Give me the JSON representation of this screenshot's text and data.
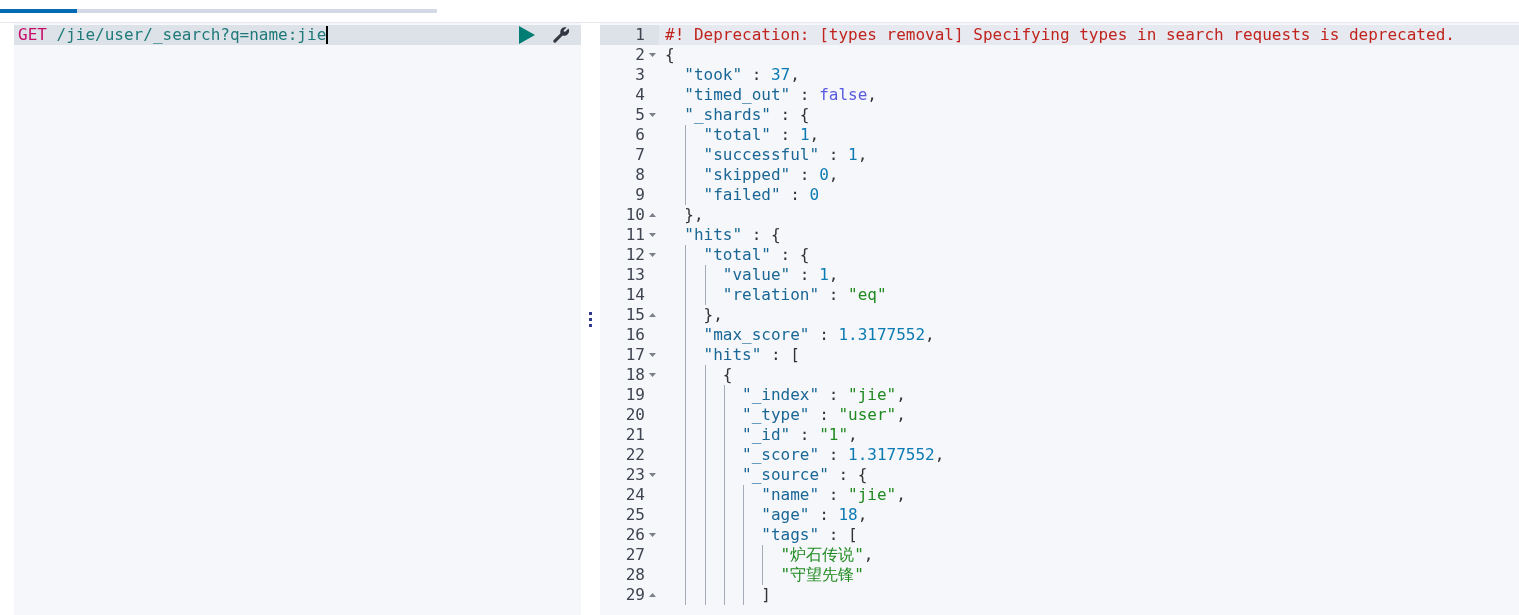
{
  "tabs": [
    {
      "selected": true
    },
    {
      "selected": false
    }
  ],
  "request": {
    "method": "GET",
    "path": "/jie/user/_search?q=name:jie"
  },
  "response": {
    "lines": [
      {
        "number": "1",
        "fold_start": false,
        "fold_end": false,
        "active": true,
        "tokens": [
          {
            "kind": "comment",
            "text": "#! Deprecation: [types removal] Specifying types in search requests is deprecated."
          }
        ]
      },
      {
        "number": "2",
        "fold_start": true,
        "fold_end": false,
        "active": false,
        "tokens": [
          {
            "kind": "punct",
            "text": "{"
          }
        ]
      },
      {
        "number": "3",
        "fold_start": false,
        "fold_end": false,
        "active": false,
        "tokens": [
          {
            "kind": "key",
            "text": "  \"took\""
          },
          {
            "kind": "punct",
            "text": " : "
          },
          {
            "kind": "num",
            "text": "37"
          },
          {
            "kind": "punct",
            "text": ","
          }
        ]
      },
      {
        "number": "4",
        "fold_start": false,
        "fold_end": false,
        "active": false,
        "tokens": [
          {
            "kind": "key",
            "text": "  \"timed_out\""
          },
          {
            "kind": "punct",
            "text": " : "
          },
          {
            "kind": "bool",
            "text": "false"
          },
          {
            "kind": "punct",
            "text": ","
          }
        ]
      },
      {
        "number": "5",
        "fold_start": true,
        "fold_end": false,
        "active": false,
        "tokens": [
          {
            "kind": "key",
            "text": "  \"_shards\""
          },
          {
            "kind": "punct",
            "text": " : {"
          }
        ]
      },
      {
        "number": "6",
        "fold_start": false,
        "fold_end": false,
        "active": false,
        "tokens": [
          {
            "kind": "key",
            "text": "    \"total\""
          },
          {
            "kind": "punct",
            "text": " : "
          },
          {
            "kind": "num",
            "text": "1"
          },
          {
            "kind": "punct",
            "text": ","
          }
        ]
      },
      {
        "number": "7",
        "fold_start": false,
        "fold_end": false,
        "active": false,
        "tokens": [
          {
            "kind": "key",
            "text": "    \"successful\""
          },
          {
            "kind": "punct",
            "text": " : "
          },
          {
            "kind": "num",
            "text": "1"
          },
          {
            "kind": "punct",
            "text": ","
          }
        ]
      },
      {
        "number": "8",
        "fold_start": false,
        "fold_end": false,
        "active": false,
        "tokens": [
          {
            "kind": "key",
            "text": "    \"skipped\""
          },
          {
            "kind": "punct",
            "text": " : "
          },
          {
            "kind": "num",
            "text": "0"
          },
          {
            "kind": "punct",
            "text": ","
          }
        ]
      },
      {
        "number": "9",
        "fold_start": false,
        "fold_end": false,
        "active": false,
        "tokens": [
          {
            "kind": "key",
            "text": "    \"failed\""
          },
          {
            "kind": "punct",
            "text": " : "
          },
          {
            "kind": "num",
            "text": "0"
          }
        ]
      },
      {
        "number": "10",
        "fold_start": false,
        "fold_end": true,
        "active": false,
        "tokens": [
          {
            "kind": "punct",
            "text": "  },"
          }
        ]
      },
      {
        "number": "11",
        "fold_start": true,
        "fold_end": false,
        "active": false,
        "tokens": [
          {
            "kind": "key",
            "text": "  \"hits\""
          },
          {
            "kind": "punct",
            "text": " : {"
          }
        ]
      },
      {
        "number": "12",
        "fold_start": true,
        "fold_end": false,
        "active": false,
        "tokens": [
          {
            "kind": "key",
            "text": "    \"total\""
          },
          {
            "kind": "punct",
            "text": " : {"
          }
        ]
      },
      {
        "number": "13",
        "fold_start": false,
        "fold_end": false,
        "active": false,
        "tokens": [
          {
            "kind": "key",
            "text": "      \"value\""
          },
          {
            "kind": "punct",
            "text": " : "
          },
          {
            "kind": "num",
            "text": "1"
          },
          {
            "kind": "punct",
            "text": ","
          }
        ]
      },
      {
        "number": "14",
        "fold_start": false,
        "fold_end": false,
        "active": false,
        "tokens": [
          {
            "kind": "key",
            "text": "      \"relation\""
          },
          {
            "kind": "punct",
            "text": " : "
          },
          {
            "kind": "str",
            "text": "\"eq\""
          }
        ]
      },
      {
        "number": "15",
        "fold_start": false,
        "fold_end": true,
        "active": false,
        "tokens": [
          {
            "kind": "punct",
            "text": "    },"
          }
        ]
      },
      {
        "number": "16",
        "fold_start": false,
        "fold_end": false,
        "active": false,
        "tokens": [
          {
            "kind": "key",
            "text": "    \"max_score\""
          },
          {
            "kind": "punct",
            "text": " : "
          },
          {
            "kind": "num",
            "text": "1.3177552"
          },
          {
            "kind": "punct",
            "text": ","
          }
        ]
      },
      {
        "number": "17",
        "fold_start": true,
        "fold_end": false,
        "active": false,
        "tokens": [
          {
            "kind": "key",
            "text": "    \"hits\""
          },
          {
            "kind": "punct",
            "text": " : ["
          }
        ]
      },
      {
        "number": "18",
        "fold_start": true,
        "fold_end": false,
        "active": false,
        "tokens": [
          {
            "kind": "punct",
            "text": "      {"
          }
        ]
      },
      {
        "number": "19",
        "fold_start": false,
        "fold_end": false,
        "active": false,
        "tokens": [
          {
            "kind": "key",
            "text": "        \"_index\""
          },
          {
            "kind": "punct",
            "text": " : "
          },
          {
            "kind": "str",
            "text": "\"jie\""
          },
          {
            "kind": "punct",
            "text": ","
          }
        ]
      },
      {
        "number": "20",
        "fold_start": false,
        "fold_end": false,
        "active": false,
        "tokens": [
          {
            "kind": "key",
            "text": "        \"_type\""
          },
          {
            "kind": "punct",
            "text": " : "
          },
          {
            "kind": "str",
            "text": "\"user\""
          },
          {
            "kind": "punct",
            "text": ","
          }
        ]
      },
      {
        "number": "21",
        "fold_start": false,
        "fold_end": false,
        "active": false,
        "tokens": [
          {
            "kind": "key",
            "text": "        \"_id\""
          },
          {
            "kind": "punct",
            "text": " : "
          },
          {
            "kind": "str",
            "text": "\"1\""
          },
          {
            "kind": "punct",
            "text": ","
          }
        ]
      },
      {
        "number": "22",
        "fold_start": false,
        "fold_end": false,
        "active": false,
        "tokens": [
          {
            "kind": "key",
            "text": "        \"_score\""
          },
          {
            "kind": "punct",
            "text": " : "
          },
          {
            "kind": "num",
            "text": "1.3177552"
          },
          {
            "kind": "punct",
            "text": ","
          }
        ]
      },
      {
        "number": "23",
        "fold_start": true,
        "fold_end": false,
        "active": false,
        "tokens": [
          {
            "kind": "key",
            "text": "        \"_source\""
          },
          {
            "kind": "punct",
            "text": " : {"
          }
        ]
      },
      {
        "number": "24",
        "fold_start": false,
        "fold_end": false,
        "active": false,
        "tokens": [
          {
            "kind": "key",
            "text": "          \"name\""
          },
          {
            "kind": "punct",
            "text": " : "
          },
          {
            "kind": "str",
            "text": "\"jie\""
          },
          {
            "kind": "punct",
            "text": ","
          }
        ]
      },
      {
        "number": "25",
        "fold_start": false,
        "fold_end": false,
        "active": false,
        "tokens": [
          {
            "kind": "key",
            "text": "          \"age\""
          },
          {
            "kind": "punct",
            "text": " : "
          },
          {
            "kind": "num",
            "text": "18"
          },
          {
            "kind": "punct",
            "text": ","
          }
        ]
      },
      {
        "number": "26",
        "fold_start": true,
        "fold_end": false,
        "active": false,
        "tokens": [
          {
            "kind": "key",
            "text": "          \"tags\""
          },
          {
            "kind": "punct",
            "text": " : ["
          }
        ]
      },
      {
        "number": "27",
        "fold_start": false,
        "fold_end": false,
        "active": false,
        "tokens": [
          {
            "kind": "str",
            "text": "            \"炉石传说\""
          },
          {
            "kind": "punct",
            "text": ","
          }
        ]
      },
      {
        "number": "28",
        "fold_start": false,
        "fold_end": false,
        "active": false,
        "tokens": [
          {
            "kind": "str",
            "text": "            \"守望先锋\""
          }
        ]
      },
      {
        "number": "29",
        "fold_start": false,
        "fold_end": true,
        "active": false,
        "tokens": [
          {
            "kind": "punct",
            "text": "          ]"
          }
        ]
      }
    ]
  }
}
